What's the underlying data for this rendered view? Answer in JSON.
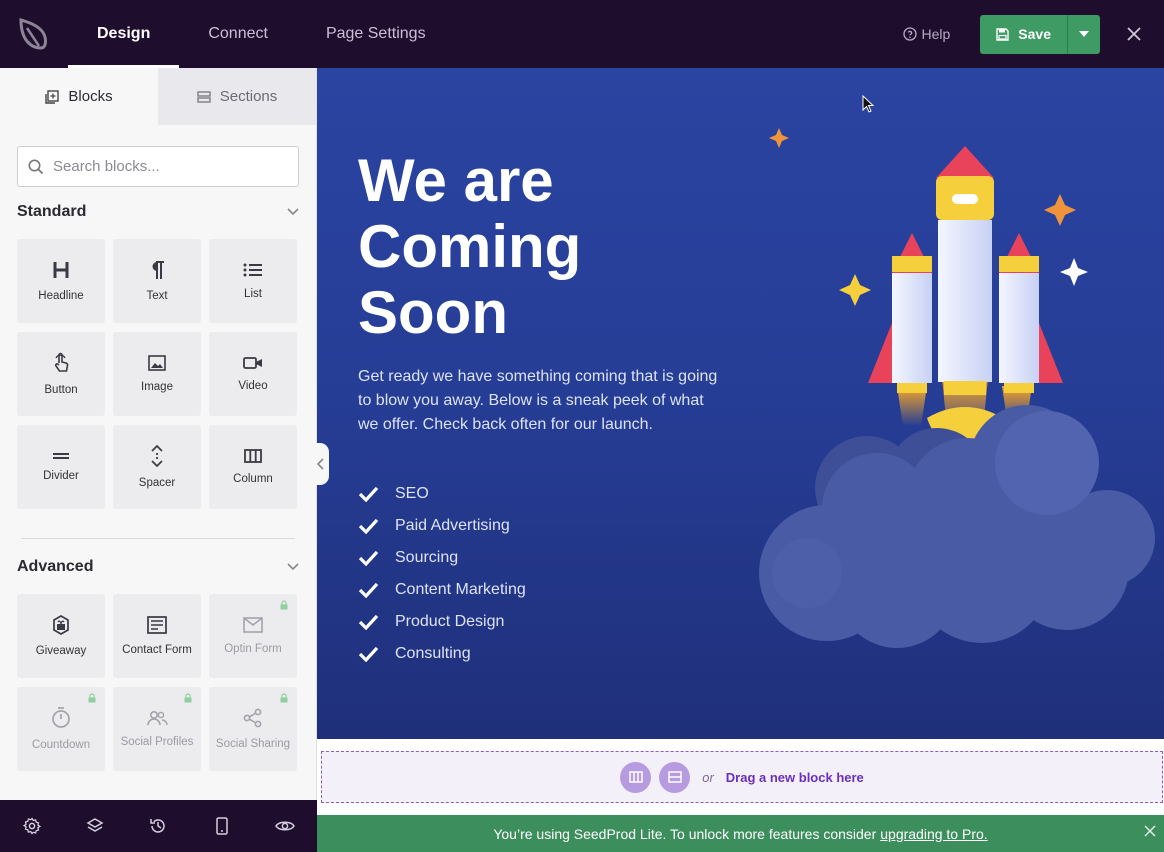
{
  "topbar": {
    "tabs": [
      {
        "label": "Design",
        "active": true
      },
      {
        "label": "Connect",
        "active": false
      },
      {
        "label": "Page Settings",
        "active": false
      }
    ],
    "help_label": "Help",
    "save_label": "Save",
    "icons": [
      "seedprod-logo-icon",
      "help-icon",
      "save-icon",
      "caret-down-icon",
      "close-icon"
    ]
  },
  "sidebar": {
    "tabs": [
      {
        "label": "Blocks",
        "icon": "blocks-icon",
        "active": true
      },
      {
        "label": "Sections",
        "icon": "sections-icon",
        "active": false
      }
    ],
    "search": {
      "placeholder": "Search blocks..."
    },
    "standard": {
      "title": "Standard",
      "blocks": [
        {
          "label": "Headline",
          "icon": "headline-icon"
        },
        {
          "label": "Text",
          "icon": "paragraph-icon"
        },
        {
          "label": "List",
          "icon": "list-icon"
        },
        {
          "label": "Button",
          "icon": "button-icon"
        },
        {
          "label": "Image",
          "icon": "image-icon"
        },
        {
          "label": "Video",
          "icon": "video-icon"
        },
        {
          "label": "Divider",
          "icon": "divider-icon"
        },
        {
          "label": "Spacer",
          "icon": "spacer-icon"
        },
        {
          "label": "Column",
          "icon": "column-icon"
        }
      ]
    },
    "advanced": {
      "title": "Advanced",
      "blocks": [
        {
          "label": "Giveaway",
          "icon": "giveaway-icon",
          "locked": false
        },
        {
          "label": "Contact Form",
          "icon": "contact-form-icon",
          "locked": false
        },
        {
          "label": "Optin Form",
          "icon": "optin-form-icon",
          "locked": true
        },
        {
          "label": "Countdown",
          "icon": "countdown-icon",
          "locked": true
        },
        {
          "label": "Social Profiles",
          "icon": "social-profiles-icon",
          "locked": true
        },
        {
          "label": "Social Sharing",
          "icon": "social-sharing-icon",
          "locked": true
        }
      ]
    }
  },
  "bottombar": {
    "icons": [
      "settings-icon",
      "layers-icon",
      "history-icon",
      "mobile-preview-icon",
      "preview-eye-icon"
    ]
  },
  "canvas": {
    "title_lines": [
      "We are",
      "Coming",
      "Soon"
    ],
    "text": "Get ready we have something coming that is going to blow you away. Below is a sneak peek of what we offer. Check back often for our launch.",
    "list": [
      "SEO",
      "Paid Advertising",
      "Sourcing",
      "Content Marketing",
      "Product Design",
      "Consulting"
    ],
    "colors": {
      "background": "#2a44a1",
      "text": "#ffffff",
      "rocket_red": "#e8435a",
      "rocket_yellow": "#f6cf3c",
      "cloud": "#4a5ba5"
    }
  },
  "dropzone": {
    "or_label": "or",
    "label": "Drag a new block here",
    "icons": [
      "add-column-icon",
      "add-section-icon"
    ]
  },
  "notice": {
    "text": "You’re using SeedProd Lite. To unlock more features consider",
    "link": "upgrading to Pro."
  },
  "colors": {
    "topbar": "#1f0d2e",
    "save_green": "#3d9b63",
    "notice_green": "#3d8e5d",
    "accent_purple": "#6a2fbf"
  }
}
